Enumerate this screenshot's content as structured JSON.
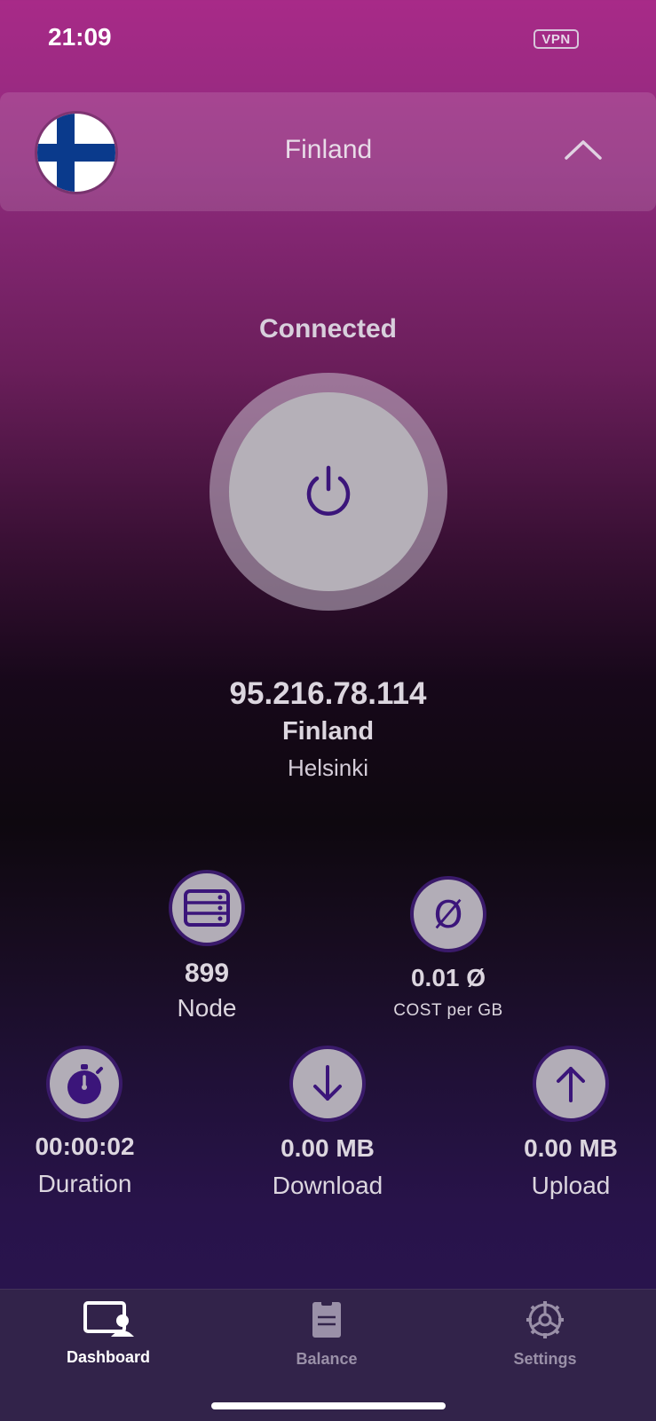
{
  "status_bar": {
    "time": "21:09",
    "vpn_badge": "VPN"
  },
  "selector": {
    "country": "Finland",
    "flag_icon": "finland-flag-icon",
    "toggle_icon": "chevron-up-icon"
  },
  "connection": {
    "status": "Connected",
    "power_icon": "power-icon",
    "ip": "95.216.78.114",
    "country": "Finland",
    "city": "Helsinki"
  },
  "stats": {
    "node": {
      "value": "899",
      "label": "Node",
      "icon": "server-icon"
    },
    "cost": {
      "value": "0.01 Ø",
      "label": "COST per GB",
      "icon": "currency-icon",
      "symbol": "Ø"
    },
    "duration": {
      "value": "00:00:02",
      "label": "Duration",
      "icon": "stopwatch-icon"
    },
    "download": {
      "value": "0.00 MB",
      "label": "Download",
      "icon": "arrow-down-icon"
    },
    "upload": {
      "value": "0.00 MB",
      "label": "Upload",
      "icon": "arrow-up-icon"
    }
  },
  "tabs": [
    {
      "label": "Dashboard",
      "icon": "dashboard-icon",
      "active": true
    },
    {
      "label": "Balance",
      "icon": "balance-icon",
      "active": false
    },
    {
      "label": "Settings",
      "icon": "settings-icon",
      "active": false
    }
  ],
  "colors": {
    "accent": "#3a1a6a",
    "icon_bg": "#b2adb7",
    "tab_active": "#ffffff",
    "tab_inactive": "#9a90a8"
  }
}
